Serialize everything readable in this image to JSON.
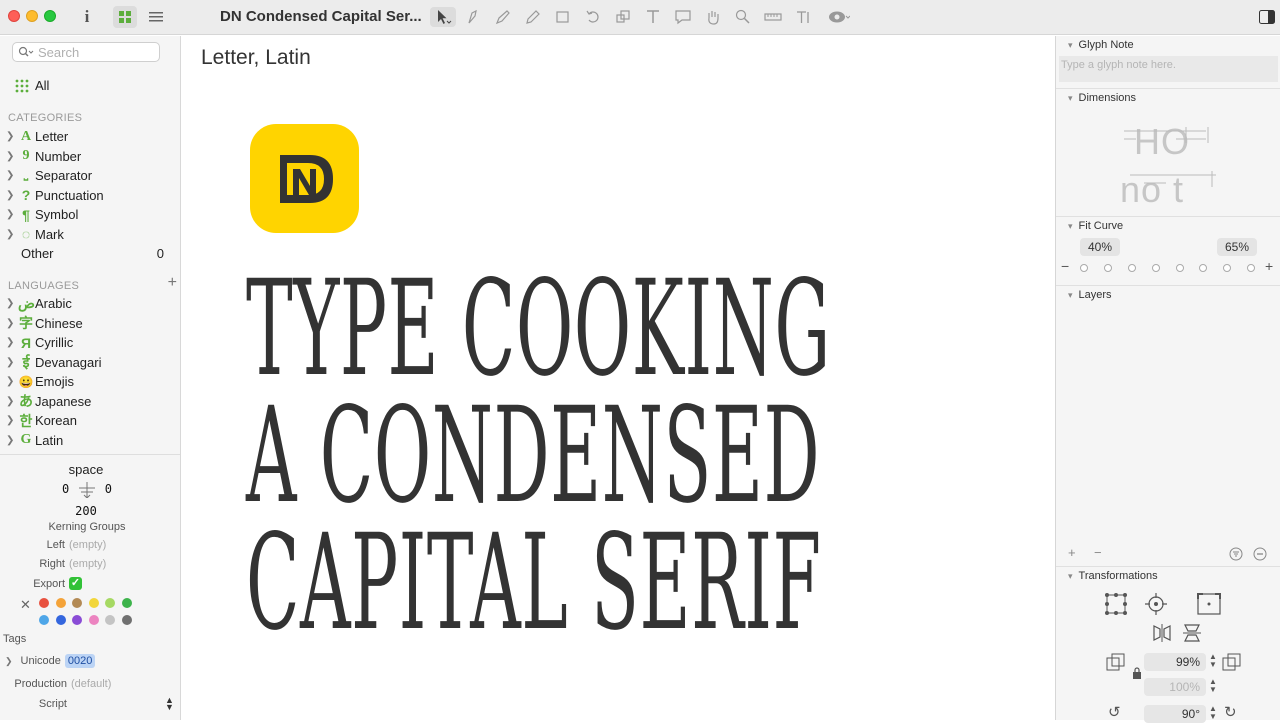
{
  "window": {
    "title": "DN Condensed Capital Ser..."
  },
  "sidebar": {
    "search_placeholder": "Search",
    "all_label": "All",
    "categories_heading": "CATEGORIES",
    "categories": [
      {
        "glyph": "A",
        "label": "Letter"
      },
      {
        "glyph": "9",
        "label": "Number"
      },
      {
        "glyph": "⎵",
        "label": "Separator"
      },
      {
        "glyph": "?",
        "label": "Punctuation"
      },
      {
        "glyph": "¶",
        "label": "Symbol"
      },
      {
        "glyph": "◌",
        "label": "Mark"
      }
    ],
    "other": {
      "label": "Other",
      "count": "0"
    },
    "languages_heading": "LANGUAGES",
    "languages": [
      {
        "glyph": "ض",
        "label": "Arabic"
      },
      {
        "glyph": "字",
        "label": "Chinese"
      },
      {
        "glyph": "Я",
        "label": "Cyrillic"
      },
      {
        "glyph": "ई",
        "label": "Devanagari"
      },
      {
        "glyph": "😀",
        "label": "Emojis"
      },
      {
        "glyph": "あ",
        "label": "Japanese"
      },
      {
        "glyph": "한",
        "label": "Korean"
      },
      {
        "glyph": "G",
        "label": "Latin"
      }
    ]
  },
  "glyph_info": {
    "name": "space",
    "lsb": "0",
    "rsb": "0",
    "width": "200",
    "kerning_groups_label": "Kerning Groups",
    "left_label": "Left",
    "left_value": "(empty)",
    "right_label": "Right",
    "right_value": "(empty)",
    "export_label": "Export",
    "export_checked": true,
    "color_swatches": [
      "#e8513f",
      "#f4a339",
      "#b38a55",
      "#f2d63a",
      "#a6d963",
      "#3db34b",
      "#4ea6e8",
      "#3466de",
      "#8a4cd6",
      "#ec84c0",
      "#c4c4c4",
      "#707070"
    ],
    "tags_label": "Tags",
    "unicode_label": "Unicode",
    "unicode_value": "0020",
    "production_label": "Production",
    "production_value": "(default)",
    "script_label": "Script"
  },
  "canvas": {
    "heading": "Letter, Latin",
    "logo_text": "DN",
    "logo_color": "#ffd400",
    "headline_lines": [
      "TYPE COOKING",
      "A CONDENSED",
      "CAPITAL SERIF"
    ]
  },
  "inspector": {
    "glyph_note": {
      "title": "Glyph Note",
      "placeholder": "Type a glyph note here."
    },
    "dimensions": {
      "title": "Dimensions",
      "row1": "HO",
      "row2": "no t"
    },
    "fit_curve": {
      "title": "Fit Curve",
      "left_value": "40%",
      "right_value": "65%"
    },
    "layers": {
      "title": "Layers"
    },
    "transformations": {
      "title": "Transformations",
      "scale_x": "99%",
      "scale_y": "100%",
      "rotate": "90°"
    }
  }
}
